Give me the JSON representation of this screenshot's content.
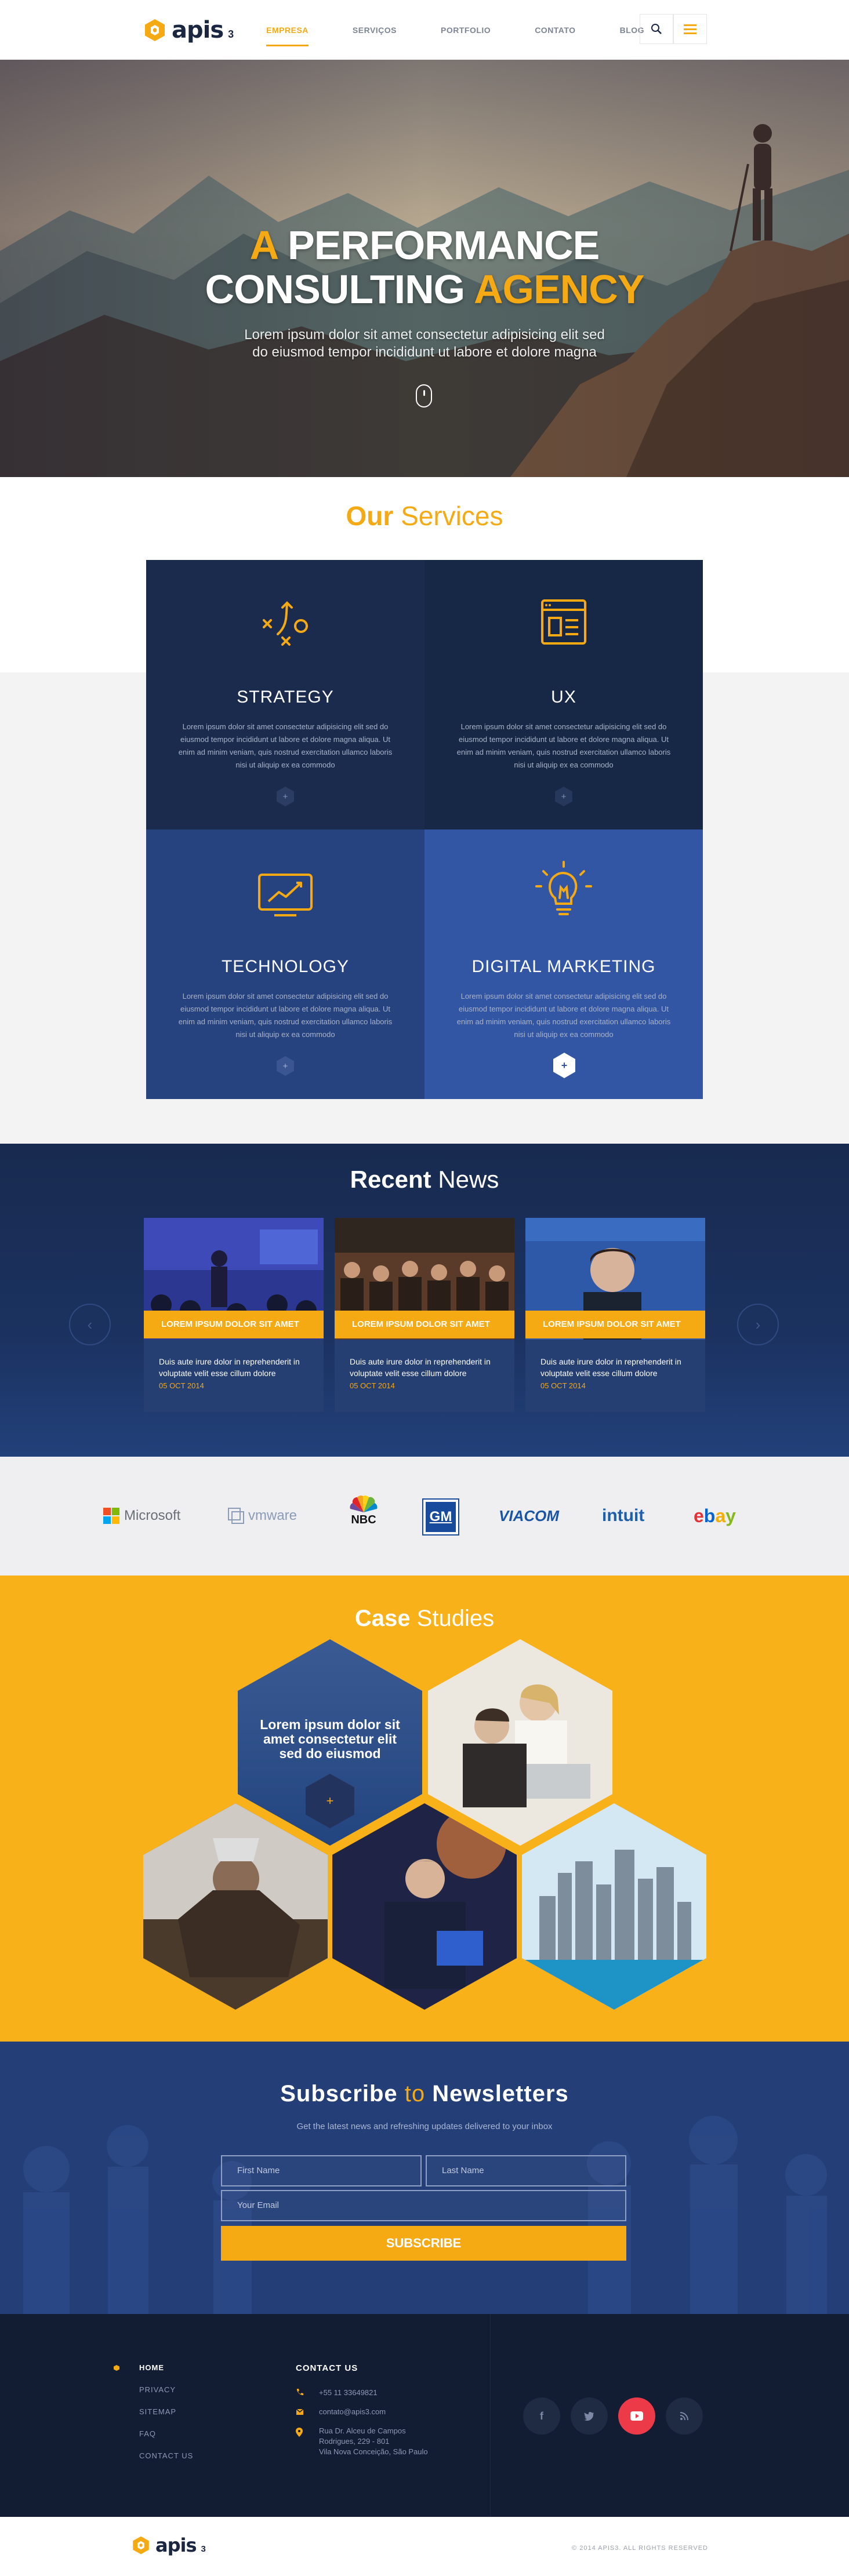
{
  "header": {
    "logo_text": "apis",
    "logo_sub": "3",
    "nav": [
      "EMPRESA",
      "SERVIÇOS",
      "PORTFOLIO",
      "CONTATO",
      "BLOG"
    ],
    "active_index": 0
  },
  "hero": {
    "title_line1_a": "A",
    "title_line1_b": " PERFORMANCE",
    "title_line2_a": "CONSULTING ",
    "title_line2_b": "AGENCY",
    "subtitle_line1": "Lorem ipsum dolor sit amet consectetur adipisicing elit sed",
    "subtitle_line2": "do eiusmod tempor incididunt ut labore et dolore magna"
  },
  "services": {
    "title_bold": "Our",
    "title_rest": " Services",
    "items": [
      {
        "title": "STRATEGY",
        "text": "Lorem ipsum dolor sit amet consectetur adipisicing elit sed do eiusmod tempor incididunt ut labore et dolore magna aliqua. Ut enim ad minim veniam, quis nostrud exercitation ullamco laboris nisi ut aliquip ex ea commodo"
      },
      {
        "title": "UX",
        "text": "Lorem ipsum dolor sit amet consectetur adipisicing elit sed do eiusmod tempor incididunt ut labore et dolore magna aliqua. Ut enim ad minim veniam, quis nostrud exercitation ullamco laboris nisi ut aliquip ex ea commodo"
      },
      {
        "title": "TECHNOLOGY",
        "text": "Lorem ipsum dolor sit amet consectetur adipisicing elit sed do eiusmod tempor incididunt ut labore et dolore magna aliqua. Ut enim ad minim veniam, quis nostrud exercitation ullamco laboris nisi ut aliquip ex ea commodo"
      },
      {
        "title": "DIGITAL MARKETING",
        "text": "Lorem ipsum dolor sit amet consectetur adipisicing elit sed do eiusmod tempor incididunt ut labore et dolore magna aliqua. Ut enim ad minim veniam, quis nostrud exercitation ullamco laboris nisi ut aliquip ex ea commodo"
      }
    ],
    "plus": "+"
  },
  "news": {
    "title_bold": "Recent",
    "title_rest": " News",
    "items": [
      {
        "headline": "LOREM IPSUM DOLOR SIT AMET",
        "text": "Duis aute irure dolor in reprehenderit in voluptate velit esse cillum dolore",
        "date": "05 OCT 2014"
      },
      {
        "headline": "LOREM IPSUM DOLOR SIT AMET",
        "text": "Duis aute irure dolor in reprehenderit in voluptate velit esse cillum dolore",
        "date": "05 OCT 2014"
      },
      {
        "headline": "LOREM IPSUM DOLOR SIT AMET",
        "text": "Duis aute irure dolor in reprehenderit in voluptate velit esse cillum dolore",
        "date": "05 OCT 2014"
      }
    ],
    "prev": "‹",
    "next": "›"
  },
  "clients": [
    "Microsoft",
    "vmware",
    "NBC",
    "GM",
    "VIACOM",
    "intuit",
    "ebay"
  ],
  "cases": {
    "title_bold": "Case",
    "title_rest": " Studies",
    "featured_caption": "Lorem ipsum dolor sit amet consectetur elit sed do eiusmod",
    "plus": "+"
  },
  "newsletter": {
    "title_a": "Subscribe ",
    "title_b": "to",
    "title_c": " Newsletters",
    "subtitle": "Get the latest news and refreshing updates delivered to your inbox",
    "first_name_placeholder": "First Name",
    "last_name_placeholder": "Last Name",
    "email_placeholder": "Your Email",
    "button": "SUBSCRIBE"
  },
  "footer": {
    "links": [
      "HOME",
      "PRIVACY",
      "SITEMAP",
      "FAQ",
      "CONTACT US"
    ],
    "contact_heading": "CONTACT US",
    "phone": "+55 11 33649821",
    "email": "contato@apis3.com",
    "address_line1": "Rua Dr. Alceu de Campos",
    "address_line2": "Rodrigues, 229 - 801",
    "address_line3": "Vila Nova Conceição, São Paulo",
    "social": [
      "f",
      "t",
      "yt",
      "rss"
    ],
    "copyright": "© 2014 APIS3. ALL RIGHTS RESERVED"
  },
  "colors": {
    "accent": "#f5a912",
    "navy": "#1b2b4e",
    "blue": "#26427f"
  }
}
